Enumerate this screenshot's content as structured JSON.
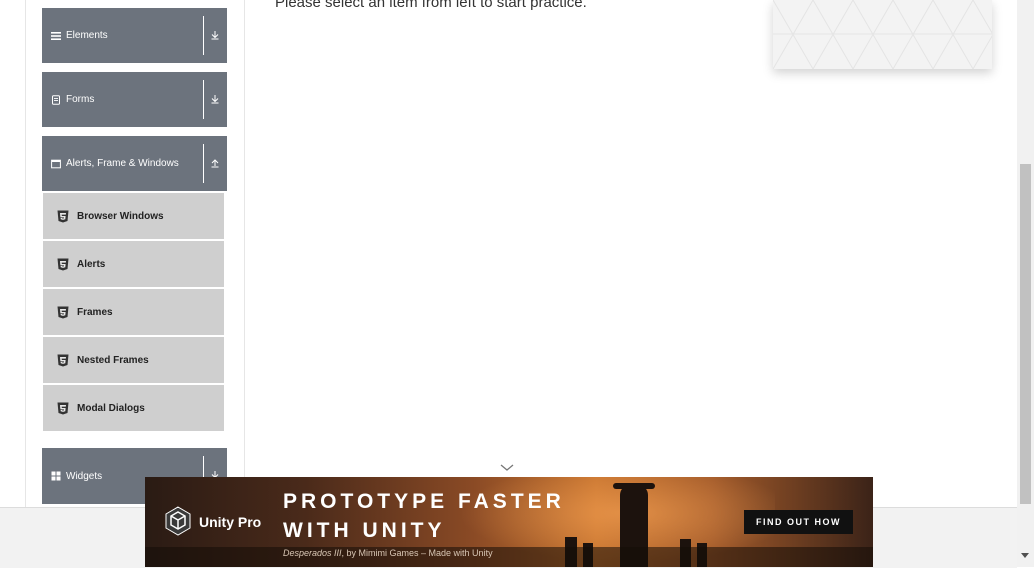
{
  "sidebar": {
    "groups": [
      {
        "label": "Elements",
        "icon": "list-icon",
        "state": "collapsed"
      },
      {
        "label": "Forms",
        "icon": "form-icon",
        "state": "collapsed"
      },
      {
        "label": "Alerts, Frame & Windows",
        "icon": "window-icon",
        "state": "expanded"
      },
      {
        "label": "Widgets",
        "icon": "grid-icon",
        "state": "collapsed"
      }
    ],
    "sub_items": [
      {
        "label": "Browser Windows",
        "icon": "html5-icon"
      },
      {
        "label": "Alerts",
        "icon": "html5-icon"
      },
      {
        "label": "Frames",
        "icon": "html5-icon"
      },
      {
        "label": "Nested Frames",
        "icon": "html5-icon"
      },
      {
        "label": "Modal Dialogs",
        "icon": "html5-icon"
      }
    ]
  },
  "main": {
    "instruction": "Please select an item from left to start practice."
  },
  "ad": {
    "brand": "Unity Pro",
    "headline_line1": "PROTOTYPE FASTER",
    "headline_line2": "WITH UNITY",
    "caption_title": "Desperados III",
    "caption_rest": ", by Mimimi Games – Made with Unity",
    "cta": "FIND OUT HOW"
  },
  "colors": {
    "group_header_bg": "#6c737d",
    "sub_item_bg": "#cfcfcf",
    "ad_cta_bg": "#111111"
  }
}
